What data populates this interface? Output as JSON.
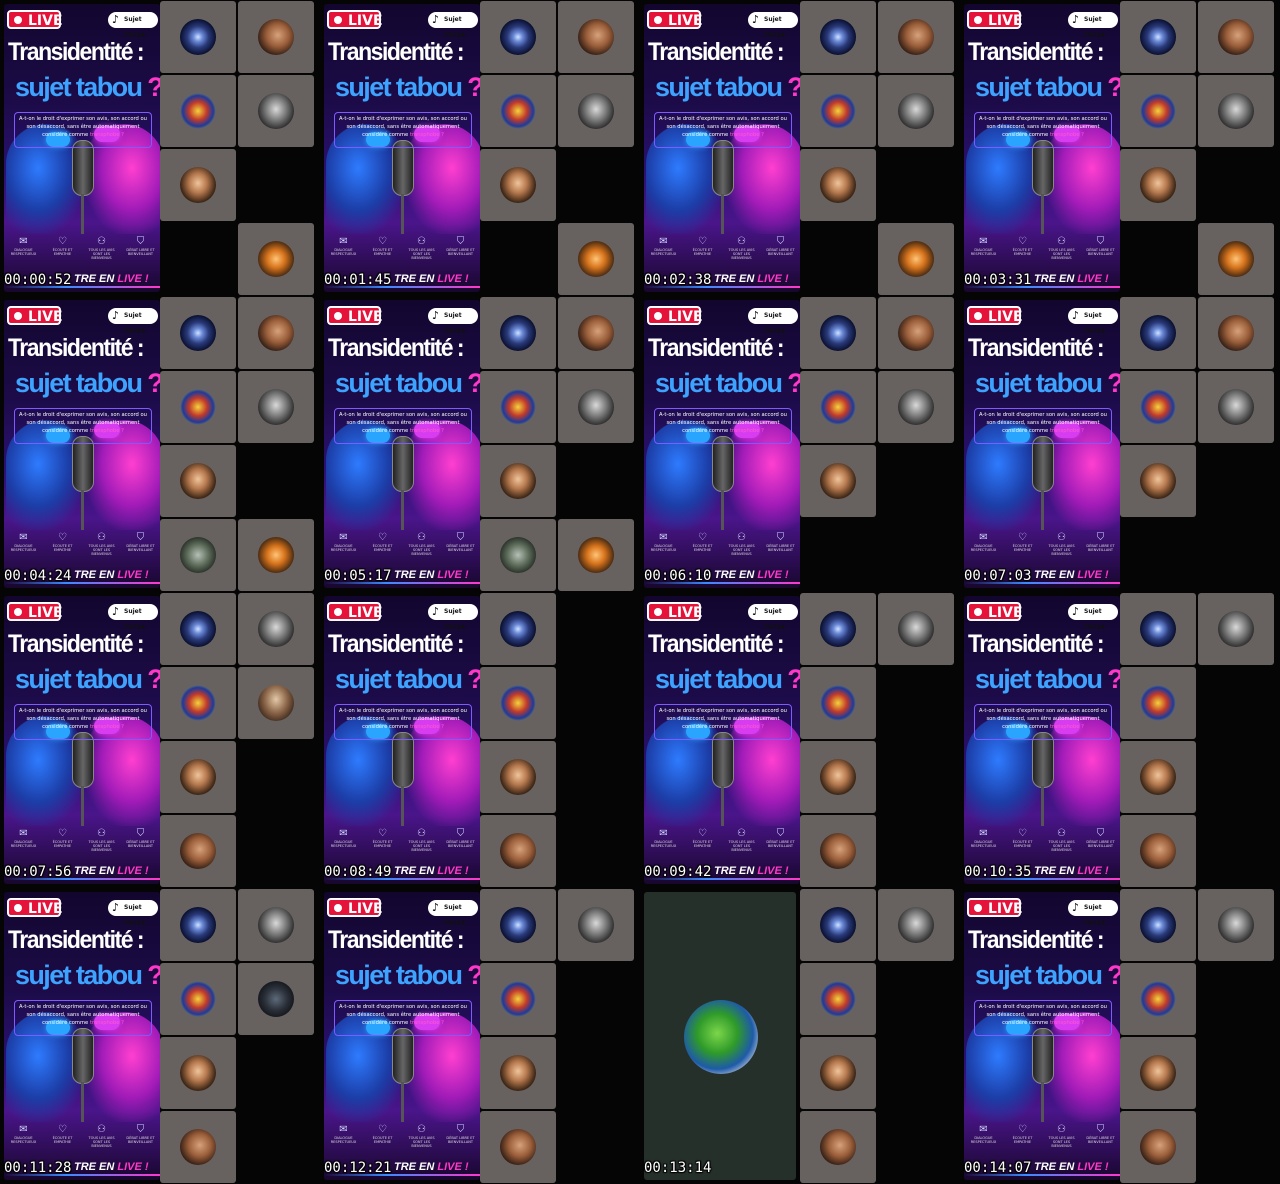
{
  "poster": {
    "live_label": "LIVE",
    "tiktok_label": "Sujet TikTok",
    "title_line1": "Transidentité :",
    "title_line2_a": "sujet tabou",
    "title_line2_b": " ?",
    "question": "A-t-on le droit d'exprimer son avis, son accord ou son désaccord, sans être automatiquement considéré comme",
    "question_highlight": "transphobe ?",
    "icons": [
      {
        "icon": "chat-icon",
        "caption": "DIALOGUE RESPECTUEUX"
      },
      {
        "icon": "heart-icon",
        "caption": "ÉCOUTE ET EMPATHIE"
      },
      {
        "icon": "people-icon",
        "caption": "TOUS LES AVIS SONT LES BIENVENUS"
      },
      {
        "icon": "shield-icon",
        "caption": "DÉBAT LIBRE ET BIENVEILLANT"
      }
    ],
    "banner_a": "TRE EN ",
    "banner_b": "LIVE !"
  },
  "frames": [
    {
      "time": "00:00:52",
      "tiles": [
        "galaxy",
        "selfie",
        "emblem",
        "bw",
        "woman",
        "",
        "",
        "cat"
      ]
    },
    {
      "time": "00:01:45",
      "tiles": [
        "galaxy",
        "selfie",
        "emblem",
        "bw",
        "woman",
        "",
        "",
        "cat"
      ]
    },
    {
      "time": "00:02:38",
      "tiles": [
        "galaxy",
        "selfie",
        "emblem",
        "bw",
        "woman",
        "",
        "",
        "cat"
      ]
    },
    {
      "time": "00:03:31",
      "tiles": [
        "galaxy",
        "selfie",
        "emblem",
        "bw",
        "woman",
        "",
        "",
        "cat"
      ]
    },
    {
      "time": "00:04:24",
      "tiles": [
        "galaxy",
        "selfie",
        "emblem",
        "bw",
        "woman",
        "",
        "moto",
        "cat"
      ]
    },
    {
      "time": "00:05:17",
      "tiles": [
        "galaxy",
        "selfie",
        "emblem",
        "bw",
        "woman",
        "",
        "moto",
        "cat"
      ]
    },
    {
      "time": "00:06:10",
      "tiles": [
        "galaxy",
        "selfie",
        "emblem",
        "bw",
        "woman",
        "",
        "",
        ""
      ]
    },
    {
      "time": "00:07:03",
      "tiles": [
        "galaxy",
        "selfie",
        "emblem",
        "bw",
        "woman",
        "",
        "",
        ""
      ]
    },
    {
      "time": "00:07:56",
      "tiles": [
        "galaxy",
        "bw",
        "emblem",
        "man",
        "woman",
        "",
        "selfie",
        ""
      ]
    },
    {
      "time": "00:08:49",
      "tiles": [
        "galaxy",
        "",
        "emblem",
        "",
        "woman",
        "",
        "selfie",
        ""
      ]
    },
    {
      "time": "00:09:42",
      "tiles": [
        "galaxy",
        "bw",
        "emblem",
        "",
        "woman",
        "",
        "selfie",
        ""
      ]
    },
    {
      "time": "00:10:35",
      "tiles": [
        "galaxy",
        "bw",
        "emblem",
        "",
        "woman",
        "",
        "selfie",
        ""
      ]
    },
    {
      "time": "00:11:28",
      "tiles": [
        "galaxy",
        "bw",
        "emblem",
        "dark",
        "woman",
        "",
        "selfie",
        ""
      ]
    },
    {
      "time": "00:12:21",
      "tiles": [
        "galaxy",
        "bw",
        "emblem",
        "",
        "woman",
        "",
        "selfie",
        ""
      ]
    },
    {
      "time": "00:13:14",
      "dragon": true,
      "tiles": [
        "galaxy",
        "bw",
        "emblem",
        "",
        "woman",
        "",
        "selfie",
        ""
      ]
    },
    {
      "time": "00:14:07",
      "tiles": [
        "galaxy",
        "bw",
        "emblem",
        "",
        "woman",
        "",
        "selfie",
        ""
      ]
    }
  ],
  "avatar_icons": {
    "galaxy": "galaxy-avatar-icon",
    "selfie": "selfie-avatar-icon",
    "emblem": "emblem-avatar-icon",
    "bw": "portrait-bw-avatar-icon",
    "woman": "woman-avatar-icon",
    "cat": "cat-avatar-icon",
    "moto": "motorcycle-avatar-icon",
    "man": "man-avatar-icon",
    "dark": "dark-avatar-icon"
  }
}
